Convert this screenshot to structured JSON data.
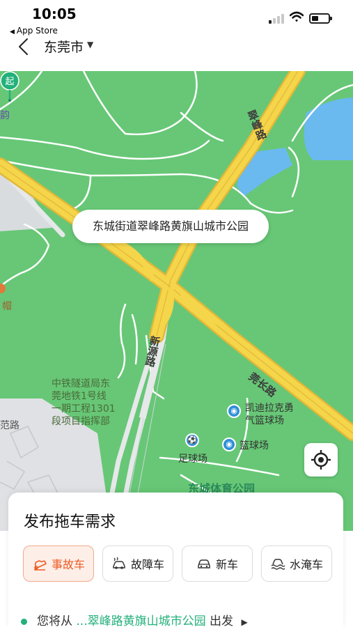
{
  "status_bar": {
    "time": "10:05",
    "back_app": "App Store"
  },
  "nav": {
    "city": "东莞市"
  },
  "map": {
    "callout": "东城街道翠峰路黄旗山城市公园",
    "start_pin_label": "起",
    "road_labels": {
      "cuifeng": "翠峰路",
      "xinyuan": "新源路",
      "guanchang": "莞长路"
    },
    "poi": {
      "tunnel": "中铁隧道局东\n莞地铁1号线\n一期工程1301\n段项目指挥部",
      "kaidi": "凯迪拉克勇\n气篮球场",
      "basketball": "篮球场",
      "football": "足球场",
      "park": "东城体育公园",
      "edge_left_top": "韵",
      "edge_left_mid": "帽",
      "edge_fan_road": "范路"
    }
  },
  "panel": {
    "title": "发布拖车需求",
    "chips": [
      {
        "label": "事故车",
        "icon": "accident-car-icon",
        "active": true
      },
      {
        "label": "故障车",
        "icon": "broken-car-icon",
        "active": false
      },
      {
        "label": "新车",
        "icon": "new-car-icon",
        "active": false
      },
      {
        "label": "水淹车",
        "icon": "flooded-car-icon",
        "active": false
      }
    ],
    "route_prefix": "您将从",
    "route_place": "...翠峰路黄旗山城市公园",
    "route_suffix": "出发"
  },
  "colors": {
    "accent": "#ee5a24",
    "brand_green": "#23b07a",
    "map_green": "#67c776",
    "road_yellow": "#f5d54a"
  }
}
